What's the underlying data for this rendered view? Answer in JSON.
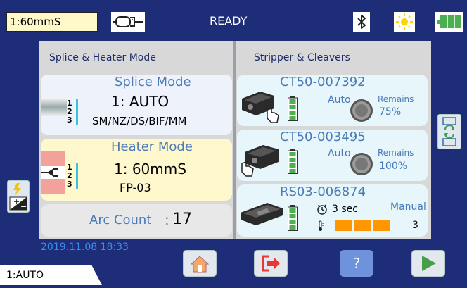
{
  "topbar": {
    "mode": "1:60mmS",
    "status": "READY",
    "icons": [
      "connector-icon",
      "bluetooth-icon",
      "brightness-icon",
      "battery-icon"
    ]
  },
  "left_panel": {
    "title": "Splice & Heater Mode",
    "splice": {
      "title": "Splice Mode",
      "mode": "1: AUTO",
      "fibers": "SM/NZ/DS/BIF/MM",
      "digits": [
        "1",
        "2",
        "3"
      ]
    },
    "heater": {
      "title": "Heater Mode",
      "mode": "1: 60mmS",
      "sleeve": "FP-03",
      "digits": [
        "1",
        "2",
        "3"
      ]
    },
    "arc": {
      "label": "Arc Count",
      "colon": ":",
      "value": "17"
    }
  },
  "right_panel": {
    "title": "Stripper & Cleavers",
    "cleavers": [
      {
        "id": "CT50-007392",
        "mode": "Auto",
        "remains_label": "Remains",
        "remains": "75%",
        "remains_fraction": 0.75
      },
      {
        "id": "CT50-003495",
        "mode": "Auto",
        "remains_label": "Remains",
        "remains": "100%",
        "remains_fraction": 1.0
      }
    ],
    "stripper": {
      "id": "RS03-006874",
      "time": "3 sec",
      "mode": "Manual",
      "level": "3",
      "level_fraction": 1.0
    }
  },
  "footer": {
    "datetime": "2019.11.08 18:33",
    "mode": "1:AUTO",
    "help": "?"
  },
  "colors": {
    "background": "#1e2d78",
    "panel": "#d8d8d8",
    "date": "#3c8cf0",
    "accent_blue": "#4a7ab8",
    "battery_green": "#4caf50",
    "bar_orange": "#ff9800",
    "exit_red": "#e53935",
    "next_green": "#43a047"
  }
}
